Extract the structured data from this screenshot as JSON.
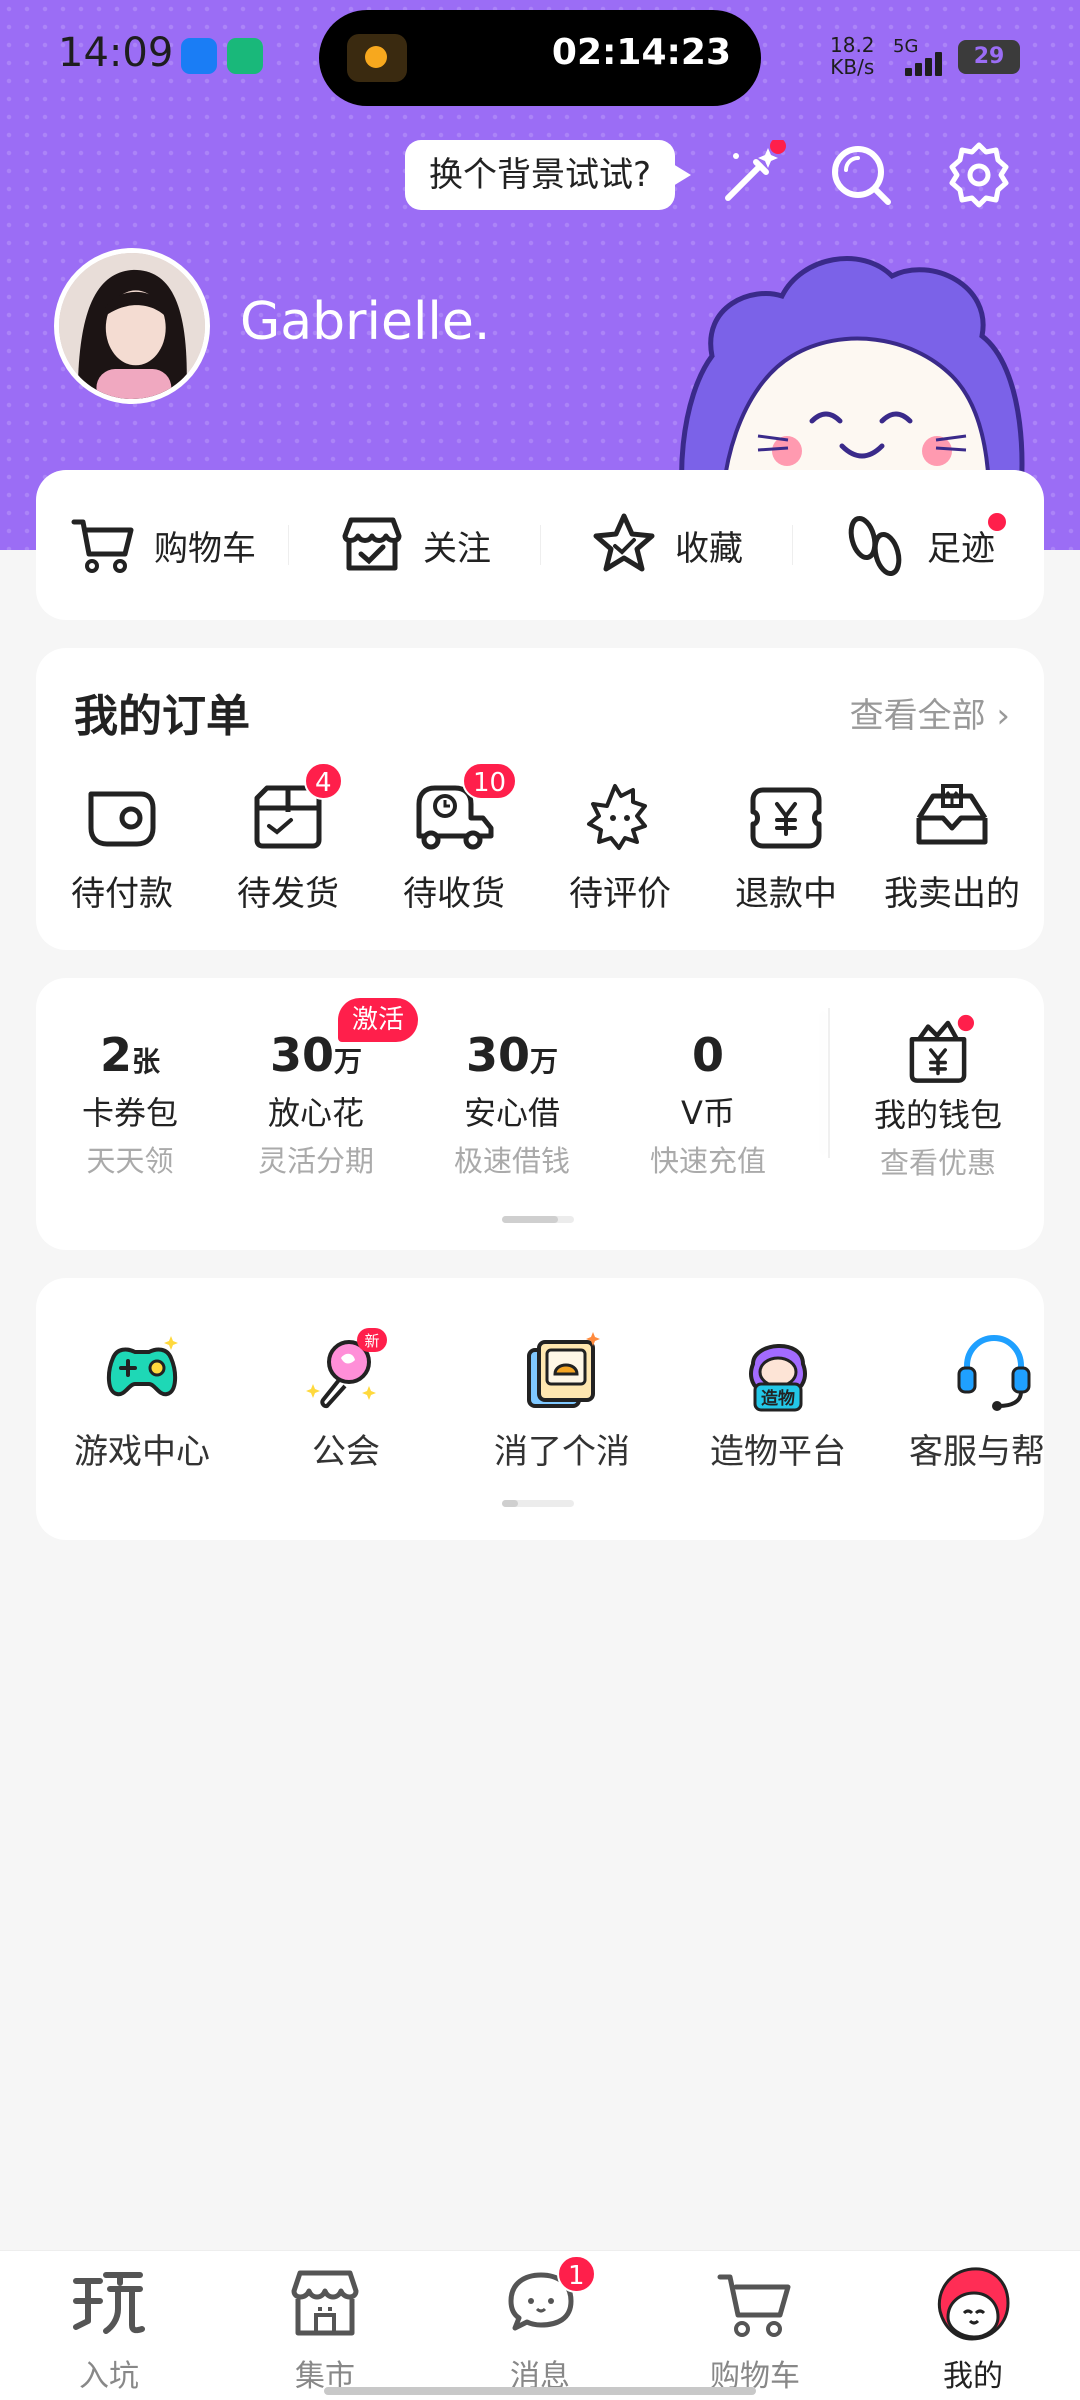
{
  "status_bar": {
    "time": "14:09",
    "timer": "02:14:23",
    "net_speed_value": "18.2",
    "net_speed_unit": "KB/s",
    "network": "5G",
    "battery": "29"
  },
  "header": {
    "bubble_text": "换个背景试试?",
    "username": "Gabrielle.",
    "accent_color": "#9b6df5"
  },
  "quick_links": [
    {
      "label": "购物车",
      "icon": "cart-icon"
    },
    {
      "label": "关注",
      "icon": "store-follow-icon"
    },
    {
      "label": "收藏",
      "icon": "star-icon"
    },
    {
      "label": "足迹",
      "icon": "footprint-icon",
      "dot": true
    }
  ],
  "orders": {
    "title": "我的订单",
    "view_all": "查看全部",
    "items": [
      {
        "label": "待付款",
        "icon": "wallet-pay-icon"
      },
      {
        "label": "待发货",
        "icon": "box-icon",
        "badge": "4"
      },
      {
        "label": "待收货",
        "icon": "delivery-truck-icon",
        "badge": "10"
      },
      {
        "label": "待评价",
        "icon": "review-bubble-icon"
      },
      {
        "label": "退款中",
        "icon": "refund-yen-icon"
      },
      {
        "label": "我卖出的",
        "icon": "sold-box-icon"
      }
    ]
  },
  "wallet": {
    "activate_tag": "激活",
    "items": [
      {
        "num": "2",
        "unit": "张",
        "name": "卡券包",
        "sub": "天天领"
      },
      {
        "num": "30",
        "unit": "万",
        "name": "放心花",
        "sub": "灵活分期"
      },
      {
        "num": "30",
        "unit": "万",
        "name": "安心借",
        "sub": "极速借钱"
      },
      {
        "num": "0",
        "unit": "",
        "name": "V币",
        "sub": "快速充值"
      }
    ],
    "my_wallet": {
      "name": "我的钱包",
      "sub": "查看优惠"
    }
  },
  "services": [
    {
      "label": "游戏中心",
      "icon": "gamepad-icon"
    },
    {
      "label": "公会",
      "icon": "lightstick-icon",
      "tag": "新"
    },
    {
      "label": "消了个消",
      "icon": "puzzle-card-icon"
    },
    {
      "label": "造物平台",
      "icon": "creator-avatar-icon",
      "icon_text": "造物"
    },
    {
      "label": "客服与帮助",
      "icon": "headset-icon"
    }
  ],
  "bottom_nav": [
    {
      "label": "入坑",
      "icon": "play-icon"
    },
    {
      "label": "集市",
      "icon": "market-icon"
    },
    {
      "label": "消息",
      "icon": "message-icon",
      "badge": "1"
    },
    {
      "label": "购物车",
      "icon": "cart-icon"
    },
    {
      "label": "我的",
      "icon": "profile-mascot-icon",
      "active": true
    }
  ]
}
